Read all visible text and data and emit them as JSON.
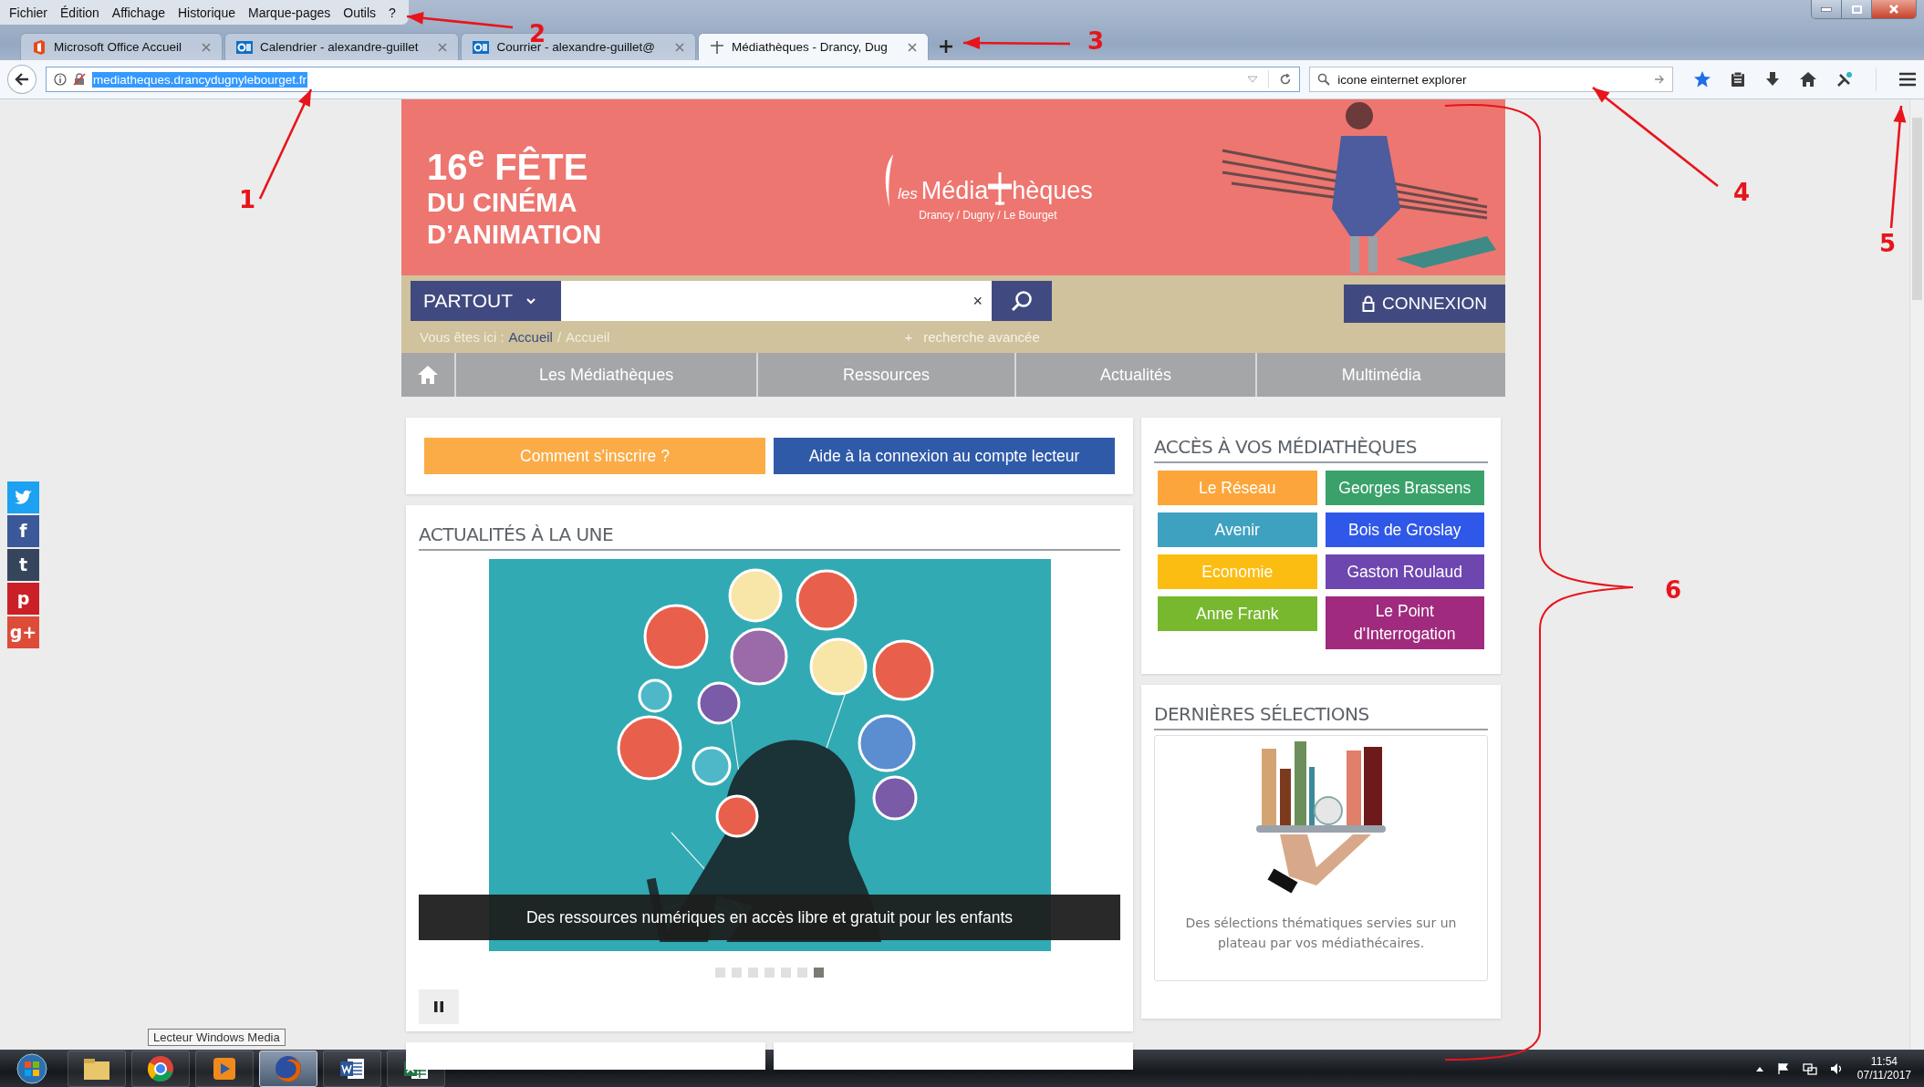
{
  "menu_bar": {
    "items": [
      "Fichier",
      "Édition",
      "Affichage",
      "Historique",
      "Marque-pages",
      "Outils",
      "?"
    ]
  },
  "tabs": [
    {
      "label": "Microsoft Office Accueil",
      "kind": "office",
      "selected": false
    },
    {
      "label": "Calendrier - alexandre-guillet",
      "kind": "outlook",
      "selected": false
    },
    {
      "label": "Courrier - alexandre-guillet@",
      "kind": "outlook",
      "selected": false
    },
    {
      "label": "Médiathèques - Drancy, Dug",
      "kind": "site",
      "selected": true
    }
  ],
  "address_bar": {
    "url": "mediatheques.drancydugnylebourget.fr",
    "url_selected": true
  },
  "search_field": {
    "value": "icone einternet explorer"
  },
  "social": [
    {
      "kind": "twitter",
      "color": "#1da1f2"
    },
    {
      "kind": "facebook",
      "glyph": "f",
      "color": "#3b5998"
    },
    {
      "kind": "tumblr",
      "glyph": "t",
      "color": "#35465c"
    },
    {
      "kind": "pinterest",
      "glyph": "p",
      "color": "#cb2027"
    },
    {
      "kind": "googleplus",
      "glyph": "g+",
      "color": "#dd4b39"
    }
  ],
  "site": {
    "banner": {
      "title": [
        "16$^{e}$ FÊTE",
        "DU CINÉMA",
        "D’ANIMATION"
      ],
      "logo": {
        "les": "les",
        "before": "Média",
        "after": "hèques",
        "subtitle": "Drancy / Dugny / Le Bourget"
      }
    },
    "search": {
      "scope": "PARTOUT",
      "clear": "×",
      "login": "CONNEXION",
      "breadcrumb_label": "Vous êtes ici :",
      "breadcrumb": [
        {
          "label": "Accueil",
          "link": true
        },
        {
          "label": "Accueil",
          "link": false
        }
      ],
      "breadcrumb_separator": "/",
      "advanced_plus": "+",
      "advanced": "recherche avancée"
    },
    "nav": [
      "Les Médiathèques",
      "Ressources",
      "Actualités",
      "Multimédia"
    ],
    "quick_buttons": [
      {
        "label": "Comment s'inscrire ?",
        "color": "#fbac47"
      },
      {
        "label": "Aide à la connexion au compte lecteur",
        "color": "#2f5aa8"
      }
    ],
    "news": {
      "heading": "ACTUALITÉS À LA UNE",
      "caption": "Des ressources numériques en accès libre et gratuit pour les enfants",
      "dots": [
        {
          "selected": false
        },
        {
          "selected": false
        },
        {
          "selected": false
        },
        {
          "selected": false
        },
        {
          "selected": false
        },
        {
          "selected": false
        },
        {
          "selected": true
        }
      ]
    },
    "libraries": {
      "heading": "ACCÈS À VOS MÉDIATHÈQUES",
      "items": [
        {
          "name": "Le Réseau",
          "color": "#fca53a"
        },
        {
          "name": "Georges Brassens",
          "color": "#3aa16b"
        },
        {
          "name": "Avenir",
          "color": "#3fa1c0"
        },
        {
          "name": "Bois de Groslay",
          "color": "#2f58e8"
        },
        {
          "name": "Economie",
          "color": "#fcbd12"
        },
        {
          "name": "Gaston Roulaud",
          "color": "#6e46b0"
        },
        {
          "name": "Anne Frank",
          "color": "#77b82e"
        },
        {
          "name": "Le Point d'Interrogation",
          "color": "#a02a7e"
        }
      ]
    },
    "selections": {
      "heading": "DERNIÈRES SÉLECTIONS",
      "text": "Des sélections thématiques servies sur un plateau par vos médiathécaires."
    }
  },
  "taskbar": {
    "tooltip": "Lecteur Windows Media",
    "apps": [
      {
        "kind": "explorer",
        "active": false
      },
      {
        "kind": "chrome",
        "active": false
      },
      {
        "kind": "media",
        "active": false
      },
      {
        "kind": "firefox",
        "active": true
      },
      {
        "kind": "word",
        "active": false
      },
      {
        "kind": "excel",
        "active": false
      }
    ],
    "time": "11:54",
    "date": "07/11/2017"
  },
  "annotations": [
    "1",
    "2",
    "3",
    "4",
    "5",
    "6"
  ]
}
